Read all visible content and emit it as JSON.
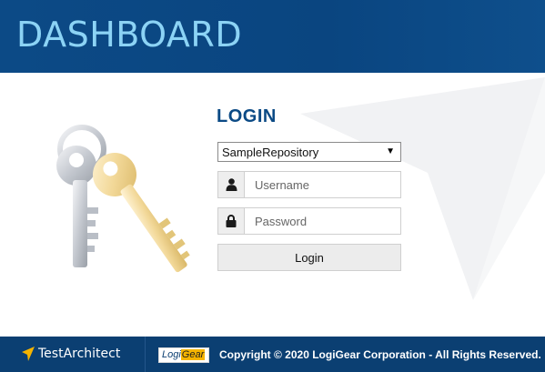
{
  "header": {
    "title": "DASHBOARD"
  },
  "login": {
    "title": "LOGIN",
    "repository": {
      "selected": "SampleRepository"
    },
    "username": {
      "placeholder": "Username",
      "icon": "user-icon"
    },
    "password": {
      "placeholder": "Password",
      "icon": "lock-icon"
    },
    "button_label": "Login"
  },
  "footer": {
    "product_name": "TestArchitect",
    "company_logo": "LogiGear",
    "copyright": "Copyright © 2020 LogiGear Corporation - All Rights Reserved."
  },
  "colors": {
    "header_bg": "#0b4a85",
    "header_title": "#8cd3f5",
    "login_title": "#0b4a85",
    "footer_bg": "#0b3f72",
    "logo_yellow": "#f5b400"
  }
}
